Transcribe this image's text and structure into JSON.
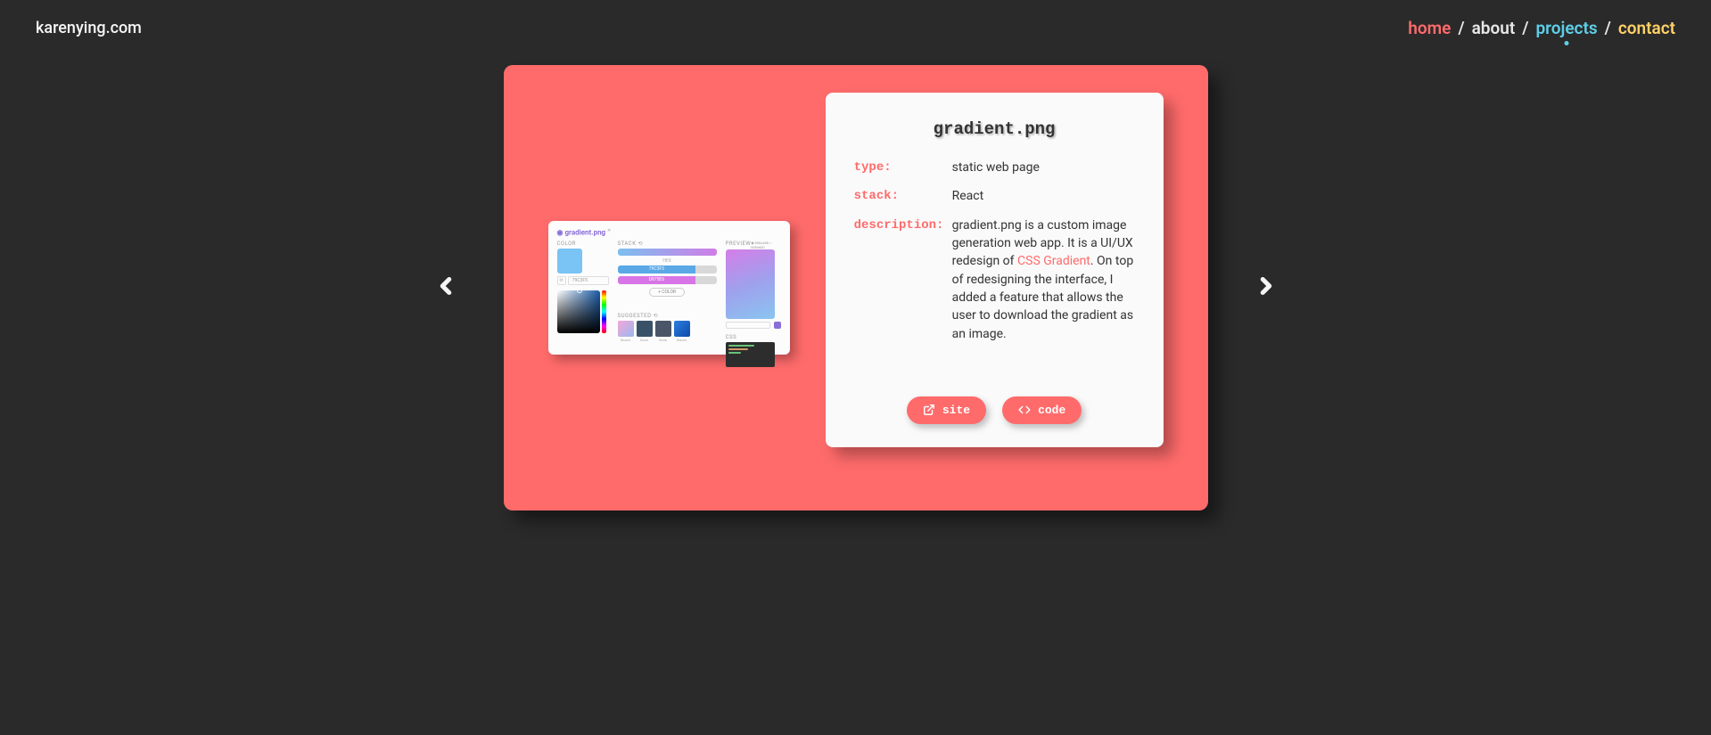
{
  "header": {
    "logo": "karenying.com",
    "nav": {
      "home": "home",
      "about": "about",
      "projects": "projects",
      "contact": "contact",
      "sep": "/"
    }
  },
  "project": {
    "title": "gradient.png",
    "labels": {
      "type": "type:",
      "stack": "stack:",
      "description": "description:"
    },
    "type": "static web page",
    "stack": "React",
    "desc_pre": "gradient.png is a custom image generation web app. It is a UI/UX redesign of ",
    "desc_link": "CSS Gradient",
    "desc_post": ". On top of redesigning the interface, I added a feature that allows the user to download the gradient as an image.",
    "buttons": {
      "site": "site",
      "code": "code"
    }
  },
  "thumbnail": {
    "title": "gradient.png",
    "color_label": "COLOR",
    "stack_label": "STACK",
    "preview_label": "PREVIEW",
    "suggested_label": "SUGGESTED",
    "css_label": "CSS",
    "add_color": "+ COLOR",
    "hex": "HEX"
  }
}
